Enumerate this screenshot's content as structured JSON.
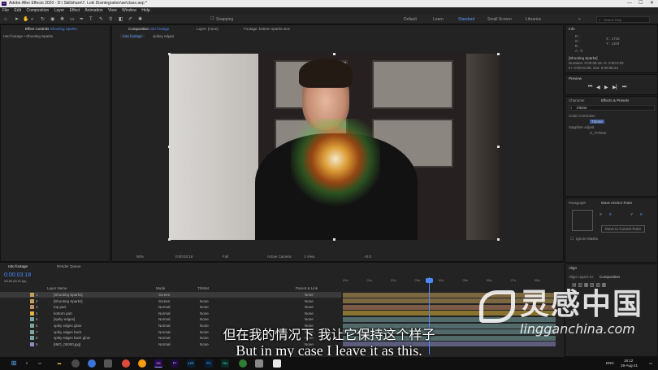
{
  "app": {
    "title": "Adobe After Effects 2020 - D:\\ Skillshare\\7. Loki Disintegration\\ae\\class.aep *",
    "minimize": "—",
    "maximize": "☐",
    "close": "✕"
  },
  "menu": [
    "File",
    "Edit",
    "Composition",
    "Layer",
    "Effect",
    "Animation",
    "View",
    "Window",
    "Help"
  ],
  "toolbar": {
    "snapping_label": "Snapping",
    "workspaces": [
      "Default",
      "Learn",
      "Standard",
      "Small Screen",
      "Libraries"
    ],
    "active_workspace": "Standard",
    "more_workspaces": "»",
    "search_placeholder": "Search Help"
  },
  "project_panel": {
    "tab_label": "Effect Controls",
    "tab_layer": "Shooting Sparks",
    "breadcrumb": "roto footage • Shooting Sparks"
  },
  "composition_panel": {
    "tab_prefix": "Composition",
    "tab_comp": "roto footage",
    "subtabs": [
      "roto footage",
      "spikey edges"
    ],
    "layer_label": "Layer: (none)",
    "footage_label": "Footage: bottom sparks.mov"
  },
  "viewer_footer": {
    "zoom": "50%",
    "timecode": "0:00:03:18",
    "resolution": "Full",
    "camera": "Active Camera",
    "views": "1 View",
    "plus": "+0.0"
  },
  "info_panel": {
    "title": "Info",
    "r": "R :",
    "g": "G :",
    "b": "B :",
    "a": "A : 0",
    "x": "X : 1742",
    "y": "Y : 1104",
    "layer_name": "[Shooting Sparks]",
    "duration": "Duration: 0:00:05:16, D: 0:00:0:02",
    "in_out": "In: 0:00:01:09, Out: 0:00:06:24"
  },
  "preview_panel": {
    "title": "Preview"
  },
  "effects_presets": {
    "tab_character": "Character",
    "tab_effects": "Effects & Presets",
    "search_value": "tritone",
    "group1": "Color Correction",
    "item1": "Tritone",
    "group2": "Sapphire Adjust",
    "item2": "S_TriTone"
  },
  "paragraph_panel": {
    "tab_paragraph": "Paragraph",
    "tab_anchor": "Move Anchor Point",
    "x_label": "X",
    "x_value": "0",
    "y_label": "Y",
    "y_value": "0",
    "move_button": "Move to Current Point",
    "ignore_masks": "Ignore Masks"
  },
  "align_panel": {
    "title": "Align",
    "align_layers_to": "Align Layers to:",
    "target": "Composition"
  },
  "timeline": {
    "tab_comp": "roto footage",
    "tab_render": "Render Queue",
    "timecode": "0:00:03:18",
    "timecode_sub": "00108 (30.00 fps)",
    "col_layer_name": "Layer Name",
    "col_mode": "Mode",
    "col_trkmat": "TrkMat",
    "col_parent": "Parent & Link",
    "ruler": [
      "00s",
      "01s",
      "02s",
      "03s",
      "04s",
      "05s",
      "06s",
      "07s",
      "08s"
    ],
    "layers": [
      {
        "num": "1",
        "name": "[Shooting Sparks]",
        "mode": "Screen",
        "trk": "",
        "parent": "None",
        "color": "#c5a15a"
      },
      {
        "num": "2",
        "name": "[Shooting Sparks]",
        "mode": "Screen",
        "trk": "None",
        "parent": "None",
        "color": "#c5a15a"
      },
      {
        "num": "3",
        "name": "top part",
        "mode": "Normal",
        "trk": "None",
        "parent": "None",
        "color": "#c78b66"
      },
      {
        "num": "4",
        "name": "bottom part",
        "mode": "Normal",
        "trk": "None",
        "parent": "None",
        "color": "#e0b63a"
      },
      {
        "num": "5",
        "name": "[spiky edges]",
        "mode": "Normal",
        "trk": "None",
        "parent": "None",
        "color": "#7aa6a6"
      },
      {
        "num": "6",
        "name": "spiky edges glow",
        "mode": "Normal",
        "trk": "None",
        "parent": "None",
        "color": "#7aa6a6"
      },
      {
        "num": "7",
        "name": "spiky edges back",
        "mode": "Normal",
        "trk": "None",
        "parent": "None",
        "color": "#7aa6a6"
      },
      {
        "num": "8",
        "name": "spiky edges back glow",
        "mode": "Normal",
        "trk": "None",
        "parent": "None",
        "color": "#7aa6a6"
      },
      {
        "num": "9",
        "name": "[IMG_00000.jpg]",
        "mode": "Normal",
        "trk": "None",
        "parent": "None",
        "color": "#8d8dc8"
      }
    ]
  },
  "subtitles": {
    "zh": "但在我的情况下 我让它保持这个样子",
    "en": "But in my case I leave it as this."
  },
  "watermark": {
    "text_zh": "灵感中国",
    "text_en": "lingganchina.com"
  },
  "taskbar": {
    "apps": [
      "Ae",
      "Pr",
      "LrC",
      "Ps",
      "Au"
    ],
    "lang": "ENG",
    "time": "16:12",
    "date": "29-Aug-21"
  }
}
